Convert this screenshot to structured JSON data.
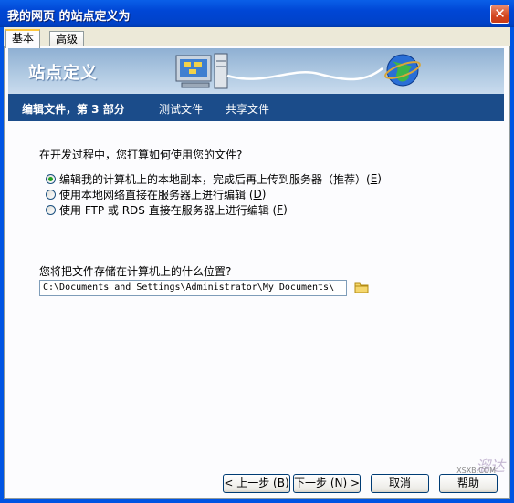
{
  "window": {
    "title": "我的网页 的站点定义为",
    "close_glyph": "✕"
  },
  "tabs": [
    {
      "label": "基本"
    },
    {
      "label": "高级"
    }
  ],
  "banner": {
    "title": "站点定义"
  },
  "steps": [
    {
      "label": "编辑文件，第 3 部分"
    },
    {
      "label": "测试文件"
    },
    {
      "label": "共享文件"
    }
  ],
  "question1": "在开发过程中，您打算如何使用您的文件?",
  "options": [
    {
      "text": "编辑我的计算机上的本地副本，完成后再上传到服务器（推荐）(",
      "key": "E",
      "end": ")",
      "checked": true
    },
    {
      "text": "使用本地网络直接在服务器上进行编辑 (",
      "key": "D",
      "end": ")",
      "checked": false
    },
    {
      "text": "使用 FTP 或 RDS 直接在服务器上进行编辑 (",
      "key": "F",
      "end": ")",
      "checked": false
    }
  ],
  "question2": "您将把文件存储在计算机上的什么位置?",
  "path_value": "C:\\Documents and Settings\\Administrator\\My Documents\\",
  "buttons": {
    "back": "< 上一步 (B)",
    "next": "下一步 (N) >",
    "cancel": "取消",
    "help": "帮助"
  },
  "watermark": {
    "text": "溜达",
    "sub": "XSXB.COM"
  },
  "colors": {
    "step_bar": "#1b4c8a",
    "banner": "#a6c1de",
    "title_bar": "#0046d5"
  }
}
